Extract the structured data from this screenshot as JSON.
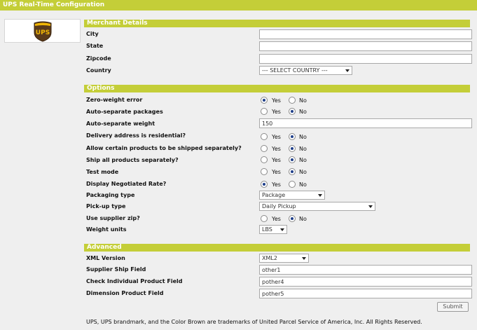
{
  "window": {
    "title": "UPS Real-Time Configuration"
  },
  "logo": {
    "text": "UPS",
    "brand_color": "#5a3a1a",
    "accent_color": "#f2b705"
  },
  "sections": {
    "merchant": "Merchant Details",
    "options": "Options",
    "advanced": "Advanced"
  },
  "merchant": {
    "city": {
      "label": "City",
      "value": ""
    },
    "state": {
      "label": "State",
      "value": ""
    },
    "zipcode": {
      "label": "Zipcode",
      "value": ""
    },
    "country": {
      "label": "Country",
      "value": "--- SELECT COUNTRY ---"
    }
  },
  "options": {
    "yes_label": "Yes",
    "no_label": "No",
    "zero_weight": {
      "label": "Zero-weight error",
      "selected": "yes"
    },
    "auto_separate": {
      "label": "Auto-separate packages",
      "selected": "no"
    },
    "auto_separate_weight": {
      "label": "Auto-separate weight",
      "value": "150"
    },
    "residential": {
      "label": "Delivery address is residential?",
      "selected": "no"
    },
    "allow_separate": {
      "label": "Allow certain products to be shipped separately?",
      "selected": "no"
    },
    "ship_all_separate": {
      "label": "Ship all products separately?",
      "selected": "no"
    },
    "test_mode": {
      "label": "Test mode",
      "selected": "no"
    },
    "negotiated_rate": {
      "label": "Display Negotiated Rate?",
      "selected": "yes"
    },
    "packaging_type": {
      "label": "Packaging type",
      "value": "Package"
    },
    "pickup_type": {
      "label": "Pick-up type",
      "value": "Daily Pickup"
    },
    "supplier_zip": {
      "label": "Use supplier zip?",
      "selected": "no"
    },
    "weight_units": {
      "label": "Weight units",
      "value": "LBS"
    }
  },
  "advanced": {
    "xml_version": {
      "label": "XML Version",
      "value": "XML2"
    },
    "supplier_ship_field": {
      "label": "Supplier Ship Field",
      "value": "other1"
    },
    "check_individual_field": {
      "label": "Check Individual Product Field",
      "value": "pother4"
    },
    "dimension_field": {
      "label": "Dimension Product Field",
      "value": "pother5"
    }
  },
  "submit_label": "Submit",
  "footer": "UPS, UPS brandmark, and the Color Brown are trademarks of United Parcel Service of America, Inc. All Rights Reserved."
}
